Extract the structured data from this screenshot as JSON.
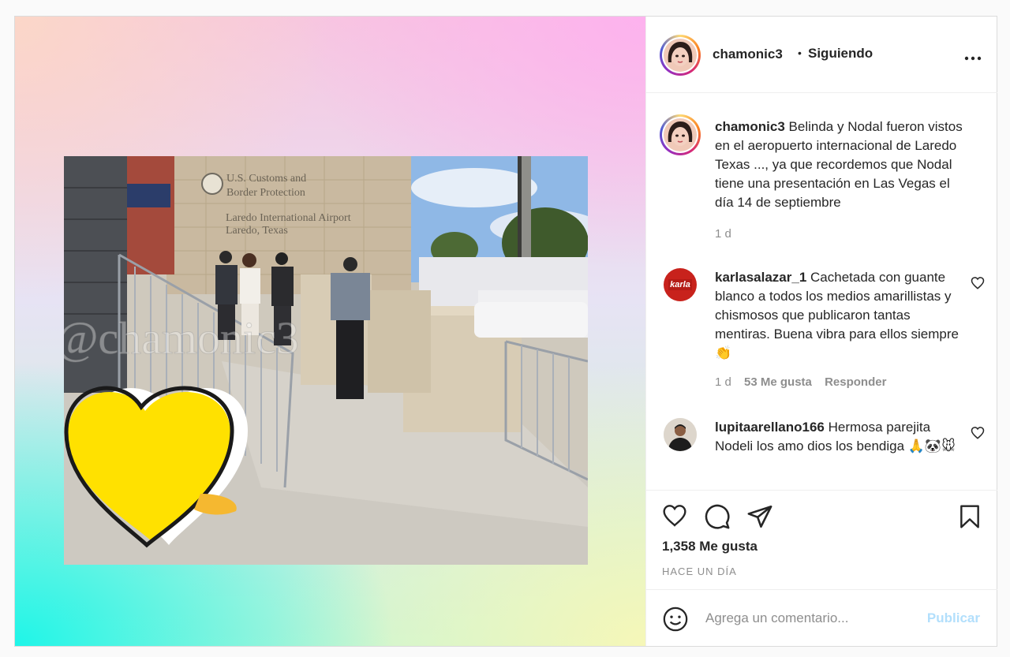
{
  "post": {
    "author": "chamonic3",
    "dot": "•",
    "follow_status": "Siguiendo",
    "watermark": "@chamonic3",
    "photo_sign": {
      "line1": "U.S. Customs and",
      "line2": "Border Protection",
      "line3": "Laredo International Airport",
      "line4": "Laredo, Texas"
    }
  },
  "caption": {
    "username": "chamonic3",
    "text": "Belinda y Nodal fueron vistos en el aeropuerto internacional de Laredo Texas ..., ya que recordemos que Nodal tiene una presentación en Las Vegas el día 14 de septiembre",
    "time": "1 d"
  },
  "comments": [
    {
      "username": "karlasalazar_1",
      "text": "Cachetada con guante blanco a todos los medios amarillistas y chismosos que publicaron tantas mentiras. Buena vibra para ellos siempre👏",
      "time": "1 d",
      "likes": "53 Me gusta",
      "reply": "Responder",
      "avatar_text": "karla"
    },
    {
      "username": "lupitaarellano166",
      "text": "Hermosa parejita Nodeli los amo dios los bendiga 🙏🐼🐭"
    }
  ],
  "actions": {
    "likes_count": "1,358 Me gusta",
    "posted": "HACE UN DÍA"
  },
  "add_comment": {
    "placeholder": "Agrega un comentario...",
    "publish": "Publicar"
  },
  "colors": {
    "text": "#262626",
    "secondary": "#8e8e8e",
    "publish_disabled": "#b2dffc",
    "heart_yellow": "#ffe100"
  },
  "icons": [
    "more-options-icon",
    "like-icon",
    "comment-icon",
    "share-icon",
    "save-icon",
    "emoji-icon",
    "comment-like-icon"
  ]
}
